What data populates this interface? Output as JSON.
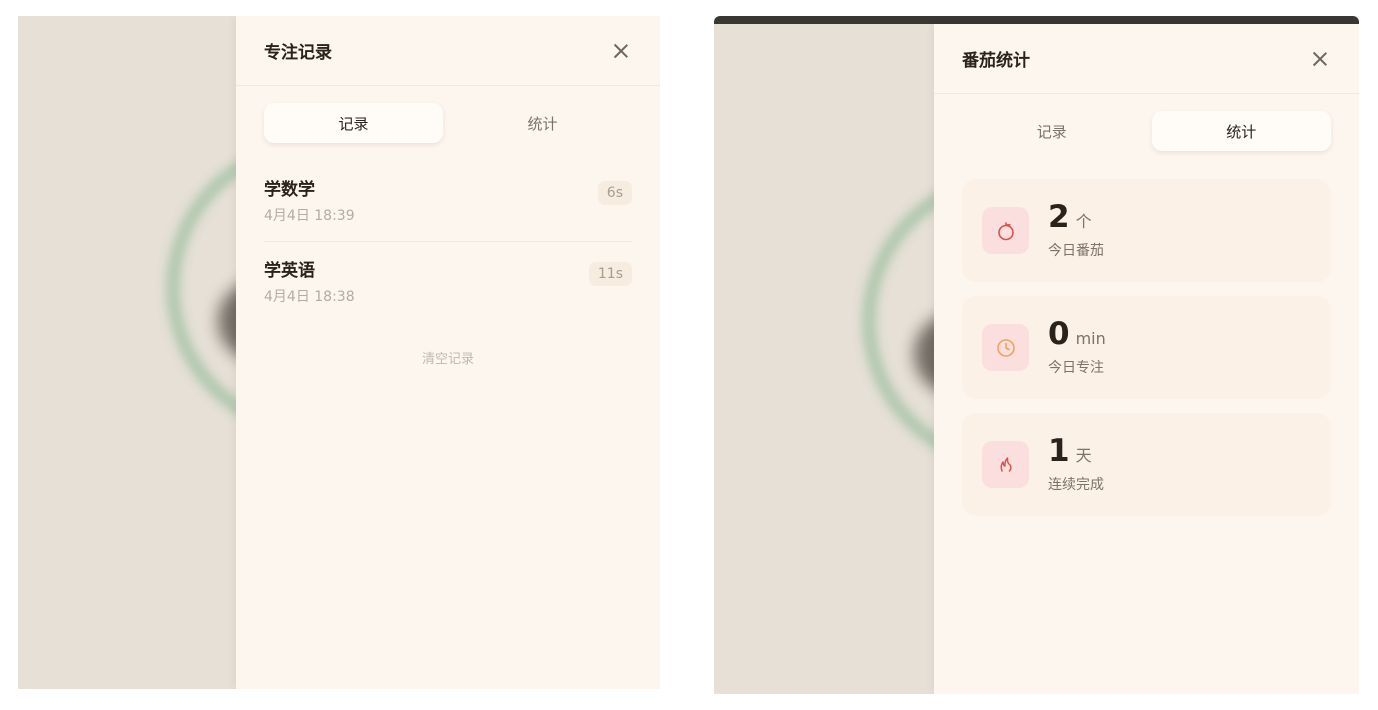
{
  "record_view": {
    "title": "专注记录",
    "tabs": [
      {
        "label": "记录",
        "active": true
      },
      {
        "label": "统计",
        "active": false
      }
    ],
    "records": [
      {
        "name": "学数学",
        "time": "4月4日 18:39",
        "duration": "6s"
      },
      {
        "name": "学英语",
        "time": "4月4日 18:38",
        "duration": "11s"
      }
    ],
    "clear_label": "清空记录"
  },
  "stats_view": {
    "title": "番茄统计",
    "tabs": [
      {
        "label": "记录",
        "active": false
      },
      {
        "label": "统计",
        "active": true
      }
    ],
    "cards": [
      {
        "icon": "tomato-icon",
        "value": "2",
        "unit": "个",
        "label": "今日番茄"
      },
      {
        "icon": "clock-icon",
        "value": "0",
        "unit": "min",
        "label": "今日专注"
      },
      {
        "icon": "flame-icon",
        "value": "1",
        "unit": "天",
        "label": "连续完成"
      }
    ]
  },
  "colors": {
    "panel_bg": "#fdf6ee",
    "card_bg": "#fcf1e7",
    "icon_bg": "#fbdede",
    "accent_red": "#d9534f",
    "accent_orange": "#f0a35e",
    "ring_green": "#a8c4a8"
  }
}
